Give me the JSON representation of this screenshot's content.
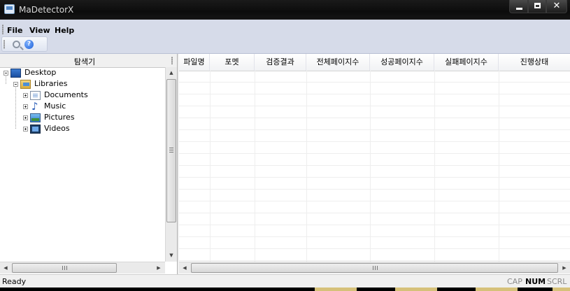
{
  "window": {
    "title": "MaDetectorX"
  },
  "menu": [
    "File",
    "View",
    "Help"
  ],
  "toolbar": {
    "help_glyph": "?"
  },
  "explorer": {
    "title": "탐색기",
    "tree": [
      {
        "label": "Desktop",
        "icon": "desktop-icon",
        "expander": "minus"
      },
      {
        "label": "Libraries",
        "icon": "libraries-icon",
        "expander": "minus"
      },
      {
        "label": "Documents",
        "icon": "documents-icon",
        "expander": "plus"
      },
      {
        "label": "Music",
        "icon": "music-icon",
        "expander": "plus"
      },
      {
        "label": "Pictures",
        "icon": "pictures-icon",
        "expander": "plus"
      },
      {
        "label": "Videos",
        "icon": "videos-icon",
        "expander": "plus"
      }
    ]
  },
  "table": {
    "columns": [
      "파일명",
      "포멧",
      "검증결과",
      "전체페이지수",
      "성공페이지수",
      "실패페이지수",
      "진행상태"
    ]
  },
  "status": {
    "text": "Ready",
    "indicators": [
      "CAP",
      "NUM",
      "SCRL"
    ]
  },
  "colors": {
    "title_bg": "#0f0f0f",
    "toolbar_bg": "#d6dbe9",
    "accent": "#2d5fb8"
  }
}
